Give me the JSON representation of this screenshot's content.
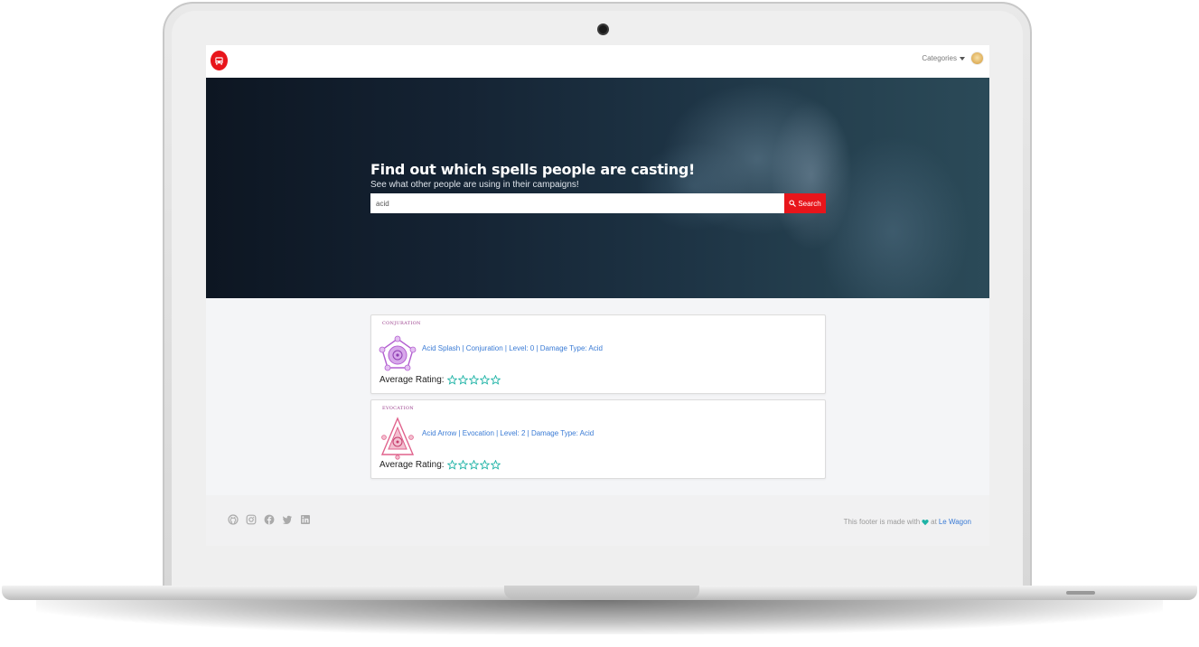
{
  "navbar": {
    "logo_icon": "bus-icon",
    "categories_label": "Categories",
    "avatar_icon": "doge-avatar"
  },
  "banner": {
    "title": "Find out which spells people are casting!",
    "subtitle": "See what other people are using in their campaigns!",
    "search": {
      "value": "acid",
      "button_label": "Search",
      "button_icon": "search-icon"
    }
  },
  "results": [
    {
      "school_label": "CONJURATION",
      "link_text": "Acid Splash | Conjuration | Level: 0 | Damage Type: Acid",
      "rating_label": "Average Rating:",
      "rating": 0,
      "rating_max": 5,
      "icon_color": "#b35fd1"
    },
    {
      "school_label": "EVOCATION",
      "link_text": "Acid Arrow | Evocation | Level: 2 | Damage Type: Acid",
      "rating_label": "Average Rating:",
      "rating": 0,
      "rating_max": 5,
      "icon_color": "#e0628c"
    }
  ],
  "footer": {
    "social_icons": [
      "github-icon",
      "instagram-icon",
      "facebook-icon",
      "twitter-icon",
      "linkedin-icon"
    ],
    "text_prefix": "This footer is made with",
    "text_mid": "at",
    "link_text": "Le Wagon"
  },
  "colors": {
    "brand_red": "#e8151b",
    "link_blue": "#3a7bd5",
    "star_teal": "#1eb3a6"
  }
}
